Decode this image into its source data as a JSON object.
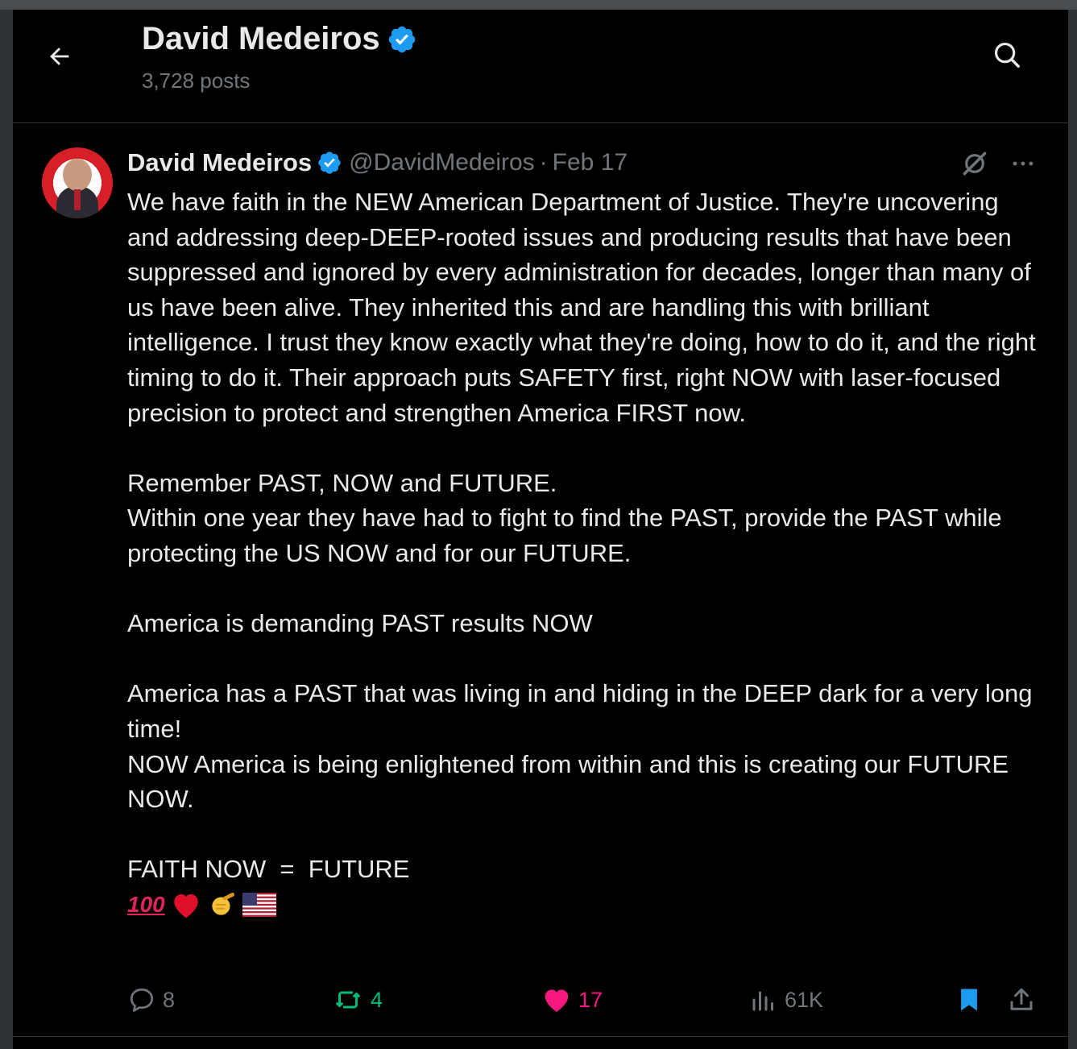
{
  "header": {
    "name": "David Medeiros",
    "posts_count": "3,728 posts"
  },
  "post": {
    "author_name": "David Medeiros",
    "handle": "@DavidMedeiros",
    "separator": "·",
    "date": "Feb 17",
    "paragraphs": [
      "We have faith in the NEW American Department of Justice. They're uncovering and addressing deep-DEEP-rooted issues and producing results that have been suppressed and ignored by every administration for decades, longer than many of us have been alive. They inherited this and are handling this with brilliant intelligence. I trust they know exactly what they're doing, how to do it, and the right timing to do it. Their approach puts SAFETY first, right NOW with laser-focused precision to protect and strengthen America FIRST now.",
      "Remember PAST, NOW and FUTURE.",
      "Within one year they have had to fight to find the PAST, provide the PAST while protecting the US NOW and for our FUTURE.",
      "America is demanding PAST results NOW",
      "America has a PAST that was living in and hiding in the DEEP dark for a very long time!",
      "NOW America is being enlightened from within and this is creating our FUTURE NOW.",
      "FAITH NOW  =  FUTURE"
    ],
    "emoji_100": "100",
    "emoji_icons": [
      "hundred-points-icon",
      "red-heart-icon",
      "pointing-hand-icon",
      "us-flag-icon"
    ]
  },
  "actions": {
    "replies": "8",
    "reposts": "4",
    "likes": "17",
    "views": "61K"
  },
  "colors": {
    "verified": "#1d9bf0",
    "repost": "#00ba7c",
    "like": "#f91880",
    "muted": "#71767b",
    "text": "#e7e9ea"
  }
}
